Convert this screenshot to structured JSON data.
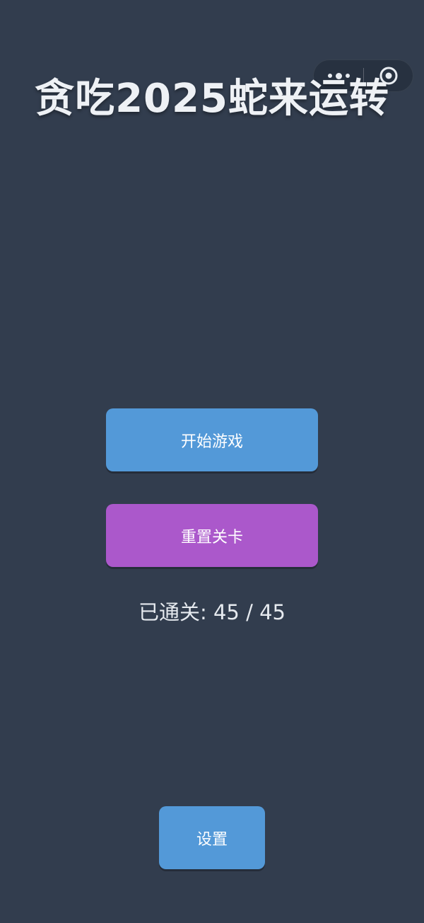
{
  "title": "贪吃2025蛇来运转",
  "capsule": {
    "more_icon": "more-dots-icon",
    "close_icon": "target-circle-icon"
  },
  "buttons": {
    "start_label": "开始游戏",
    "reset_label": "重置关卡",
    "settings_label": "设置"
  },
  "progress": {
    "label": "已通关:",
    "completed": "45",
    "separator": "/",
    "total": "45"
  },
  "colors": {
    "background": "#323d4e",
    "primary_button": "#5399d8",
    "reset_button": "#ab58cb",
    "text": "#eef1f5"
  }
}
